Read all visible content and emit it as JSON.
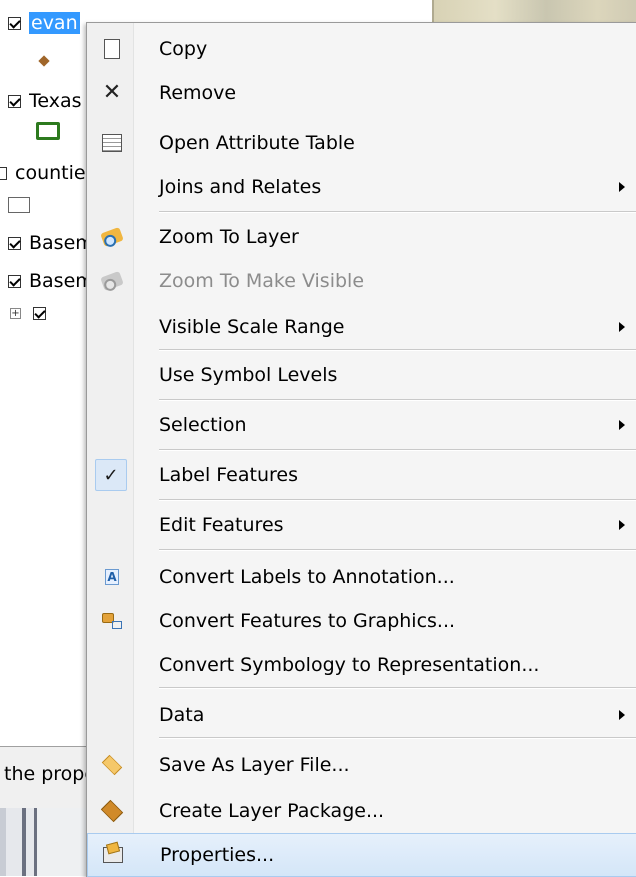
{
  "toc": {
    "layers": [
      {
        "label": "evan",
        "checked": true,
        "selected": true
      },
      {
        "label": "Texas",
        "checked": true,
        "selected": false
      },
      {
        "label": "counties",
        "checked": false,
        "selected": false
      },
      {
        "label": "Basemap",
        "checked": true,
        "selected": false
      },
      {
        "label": "Basemap",
        "checked": true,
        "selected": false
      }
    ],
    "status_text": "the properties"
  },
  "menu": {
    "items": [
      {
        "label": "Copy",
        "icon": "copy-icon"
      },
      {
        "label": "Remove",
        "icon": "remove-icon"
      },
      {
        "label": "Open Attribute Table",
        "icon": "table-icon"
      },
      {
        "label": "Joins and Relates",
        "submenu": true
      },
      {
        "label": "Zoom To Layer",
        "icon": "zoom-to-layer-icon"
      },
      {
        "label": "Zoom To Make Visible",
        "icon": "zoom-to-visible-icon",
        "disabled": true
      },
      {
        "label": "Visible Scale Range",
        "submenu": true
      },
      {
        "label": "Use Symbol Levels"
      },
      {
        "label": "Selection",
        "submenu": true
      },
      {
        "label": "Label Features",
        "checked": true
      },
      {
        "label": "Edit Features",
        "submenu": true
      },
      {
        "label": "Convert Labels to Annotation...",
        "icon": "annotation-icon"
      },
      {
        "label": "Convert Features to Graphics...",
        "icon": "graphics-icon"
      },
      {
        "label": "Convert Symbology to Representation..."
      },
      {
        "label": "Data",
        "submenu": true
      },
      {
        "label": "Save As Layer File...",
        "icon": "layer-file-icon"
      },
      {
        "label": "Create Layer Package...",
        "icon": "layer-package-icon"
      },
      {
        "label": "Properties...",
        "icon": "properties-icon",
        "highlighted": true
      }
    ]
  },
  "colors": {
    "selection": "#3399ff",
    "menu_background": "#f5f5f5",
    "highlight": "#d4e6f8"
  }
}
